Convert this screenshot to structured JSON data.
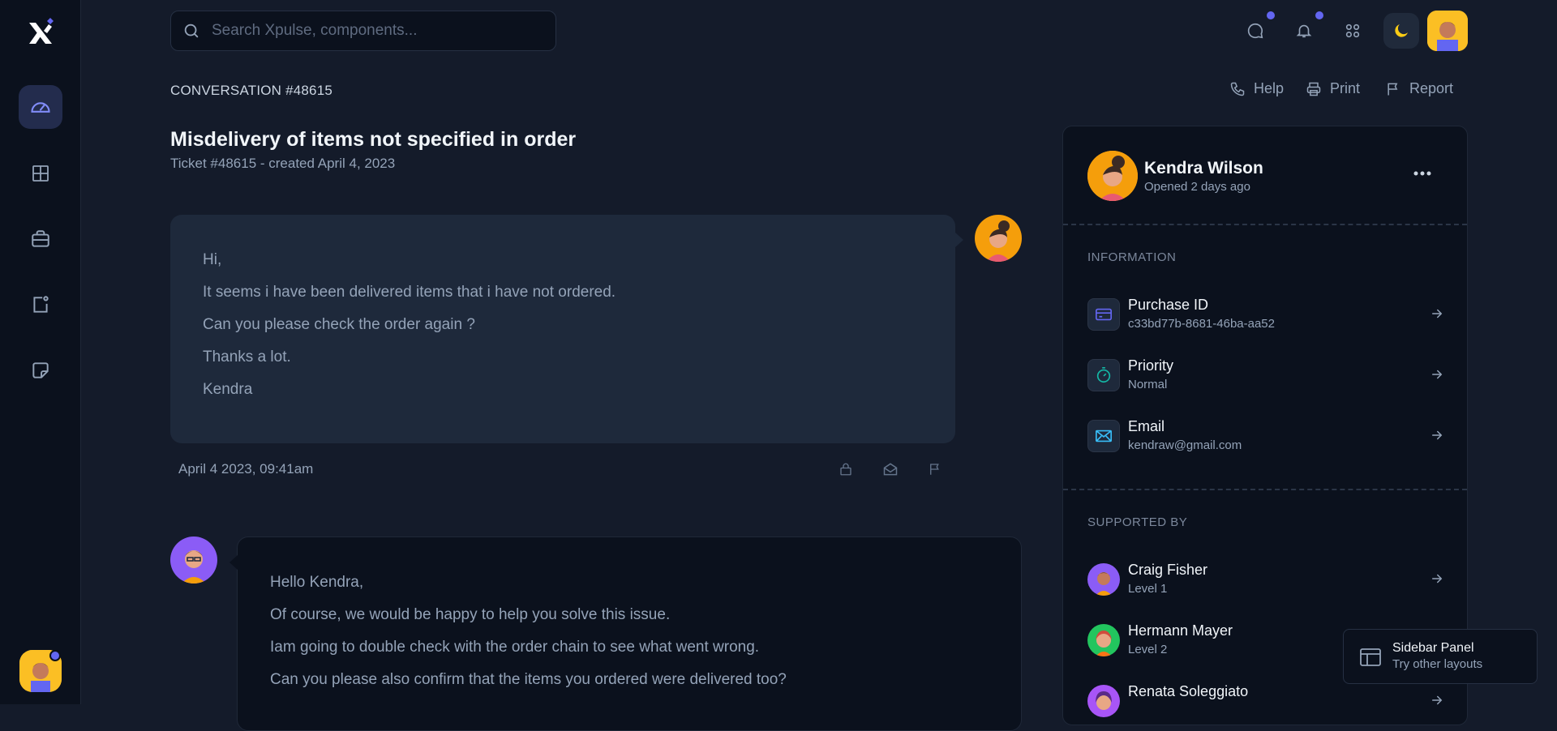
{
  "search": {
    "placeholder": "Search Xpulse, components..."
  },
  "header": {
    "conversation_id": "CONVERSATION #48615",
    "actions": {
      "help": "Help",
      "print": "Print",
      "report": "Report"
    },
    "title": "Misdelivery of items not specified in order",
    "subtitle": "Ticket #48615 - created April 4, 2023"
  },
  "messages": [
    {
      "lines": [
        "Hi,",
        "It seems i have been delivered items that i have not ordered.",
        "Can you please check the order again ?",
        "Thanks a lot.",
        "Kendra"
      ],
      "timestamp": "April 4 2023, 09:41am"
    },
    {
      "lines": [
        "Hello Kendra,",
        "Of course, we would be happy to help you solve this issue.",
        "Iam going to double check with the order chain to see what went wrong.",
        "Can you please also confirm that the items you ordered were delivered too?"
      ]
    }
  ],
  "customer": {
    "name": "Kendra Wilson",
    "opened": "Opened 2 days ago"
  },
  "information": {
    "title": "INFORMATION",
    "items": [
      {
        "label": "Purchase ID",
        "value": "c33bd77b-8681-46ba-aa52",
        "icon": "credit-card-icon"
      },
      {
        "label": "Priority",
        "value": "Normal",
        "icon": "stopwatch-icon"
      },
      {
        "label": "Email",
        "value": "kendraw@gmail.com",
        "icon": "mail-icon"
      }
    ]
  },
  "supported_by": {
    "title": "SUPPORTED BY",
    "agents": [
      {
        "name": "Craig Fisher",
        "level": "Level 1"
      },
      {
        "name": "Hermann Mayer",
        "level": "Level 2"
      },
      {
        "name": "Renata Soleggiato",
        "level": ""
      }
    ]
  },
  "floating": {
    "title": "Sidebar Panel",
    "subtitle": "Try other layouts"
  },
  "colors": {
    "accent": "#6366f1",
    "background": "#141b2a",
    "panel": "#0b111d",
    "bubble": "#1e293b"
  }
}
